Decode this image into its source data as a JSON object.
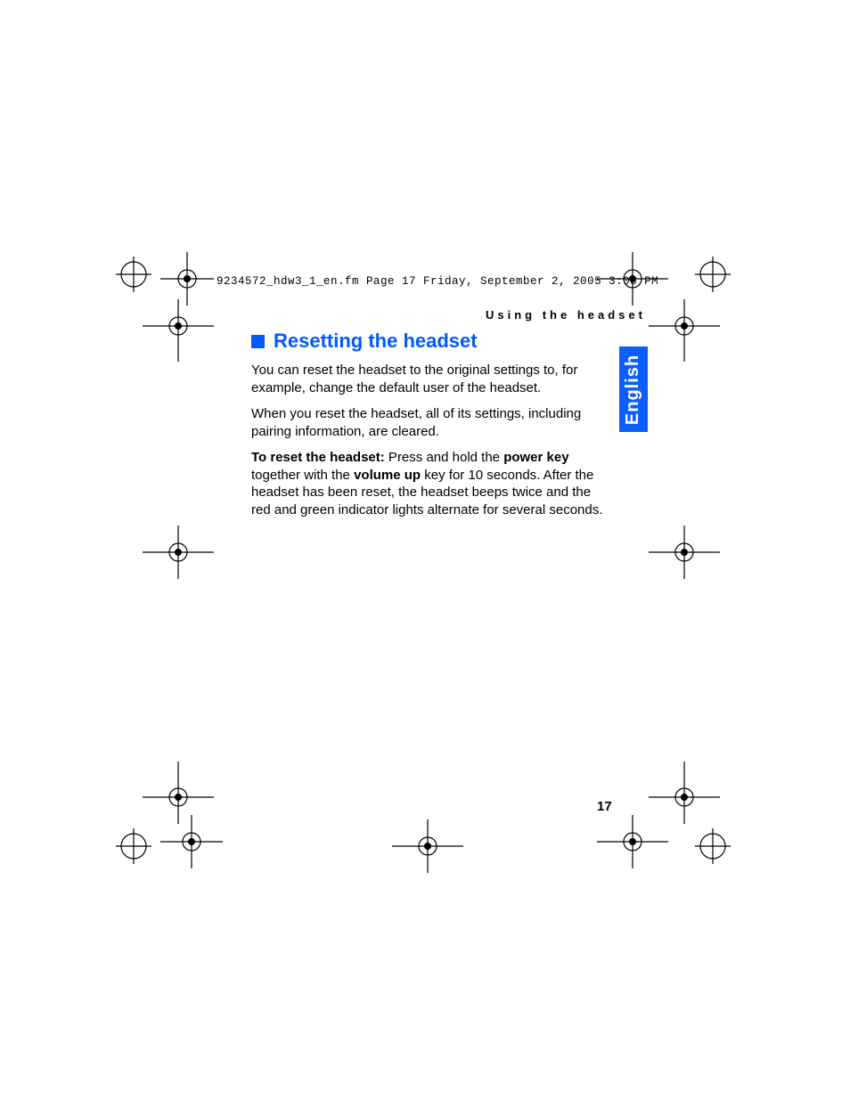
{
  "fileline": "9234572_hdw3_1_en.fm  Page 17  Friday, September 2, 2005  3:08 PM",
  "section_header": "Using the headset",
  "heading": "Resetting the headset",
  "para1": "You can reset the headset to the original settings to, for example, change the default user of the headset.",
  "para2": "When you reset the headset, all of its settings, including pairing information, are cleared.",
  "para3_lead_bold": "To reset the headset:",
  "para3_mid1": " Press and hold the ",
  "para3_bold2": "power key",
  "para3_mid2": " together with the ",
  "para3_bold3": "volume up",
  "para3_tail": " key for 10 seconds. After the headset has been reset, the headset beeps twice and the red and green indicator lights alternate for several seconds.",
  "language_tab": "English",
  "page_number": "17"
}
